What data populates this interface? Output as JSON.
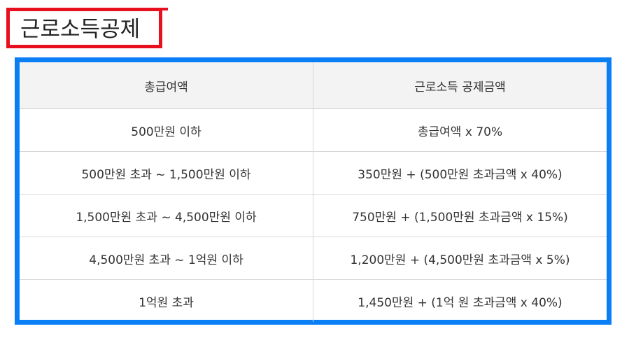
{
  "page": {
    "title": "근로소득공제"
  },
  "colors": {
    "title_border": "#e8101f",
    "table_border": "#0a7ff5",
    "header_background": "#f3f3f3"
  },
  "table": {
    "columns": [
      "총급여액",
      "근로소득 공제금액"
    ],
    "rows": [
      [
        "500만원 이하",
        "총급여액 x 70%"
      ],
      [
        "500만원 초과 ~ 1,500만원 이하",
        "350만원 + (500만원 초과금액 x 40%)"
      ],
      [
        "1,500만원 초과 ~ 4,500만원 이하",
        "750만원 + (1,500만원 초과금액 x 15%)"
      ],
      [
        "4,500만원 초과 ~ 1억원 이하",
        "1,200만원 + (4,500만원 초과금액 x 5%)"
      ],
      [
        "1억원 초과",
        "1,450만원 + (1억 원 초과금액 x 40%)"
      ]
    ]
  }
}
